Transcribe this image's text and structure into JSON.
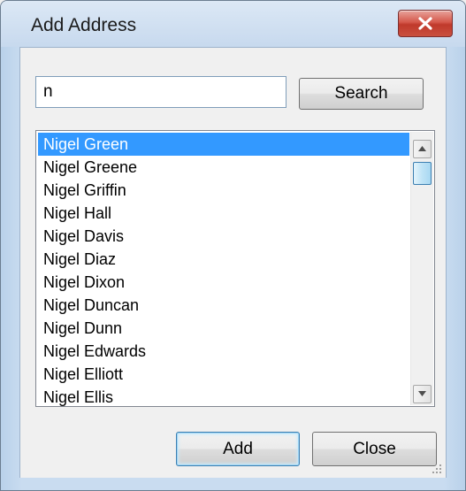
{
  "window": {
    "title": "Add Address"
  },
  "search": {
    "value": "n",
    "button_label": "Search"
  },
  "list": {
    "items": [
      "Nigel Green",
      "Nigel Greene",
      "Nigel Griffin",
      "Nigel Hall",
      "Nigel Davis",
      "Nigel Diaz",
      "Nigel Dixon",
      "Nigel Duncan",
      "Nigel Dunn",
      "Nigel Edwards",
      "Nigel Elliott",
      "Nigel Ellis"
    ],
    "selected_index": 0
  },
  "buttons": {
    "add_label": "Add",
    "close_label": "Close"
  },
  "colors": {
    "selection": "#3399ff",
    "close_button": "#c9503f"
  }
}
